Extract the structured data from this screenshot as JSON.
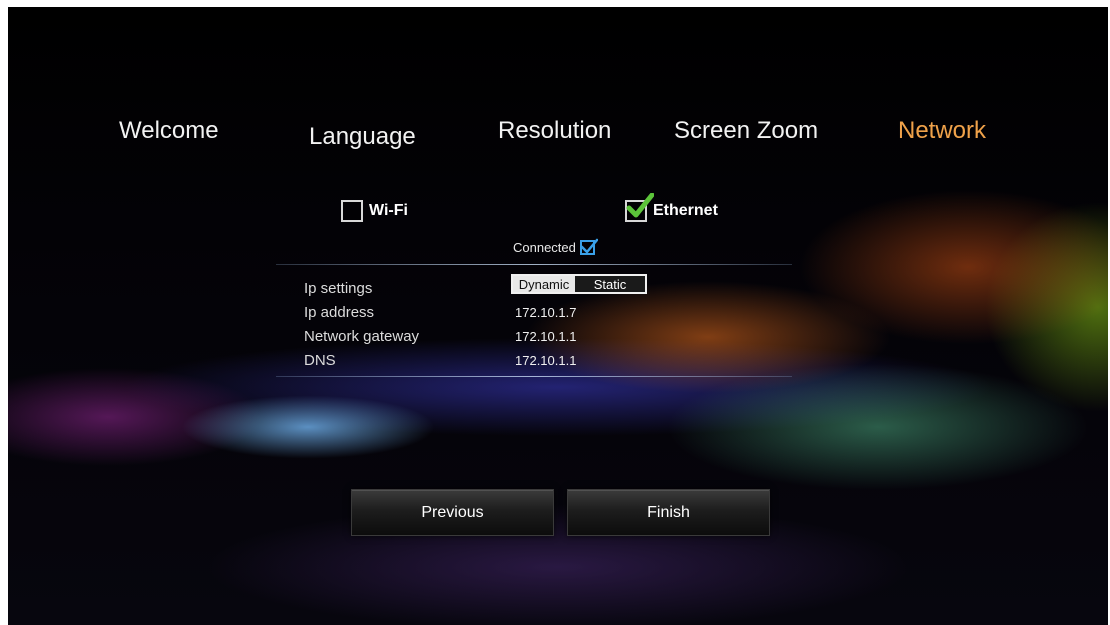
{
  "steps": {
    "welcome": "Welcome",
    "language": "Language",
    "resolution": "Resolution",
    "screen_zoom": "Screen Zoom",
    "network": "Network"
  },
  "network_options": {
    "wifi": {
      "label": "Wi-Fi",
      "checked": false
    },
    "ethernet": {
      "label": "Ethernet",
      "checked": true
    }
  },
  "status": {
    "label": "Connected",
    "checked": true
  },
  "settings": {
    "ip_settings": {
      "label": "Ip settings",
      "options": [
        "Dynamic",
        "Static"
      ],
      "selected": "Dynamic"
    },
    "ip_address": {
      "label": "Ip address",
      "value": "172.10.1.7"
    },
    "gateway": {
      "label": "Network gateway",
      "value": "172.10.1.1"
    },
    "dns": {
      "label": "DNS",
      "value": "172.10.1.1"
    }
  },
  "buttons": {
    "previous": "Previous",
    "finish": "Finish"
  },
  "colors": {
    "active_step": "#f0a24a",
    "check_green": "#5cc43a",
    "check_blue": "#3aa0e8"
  }
}
